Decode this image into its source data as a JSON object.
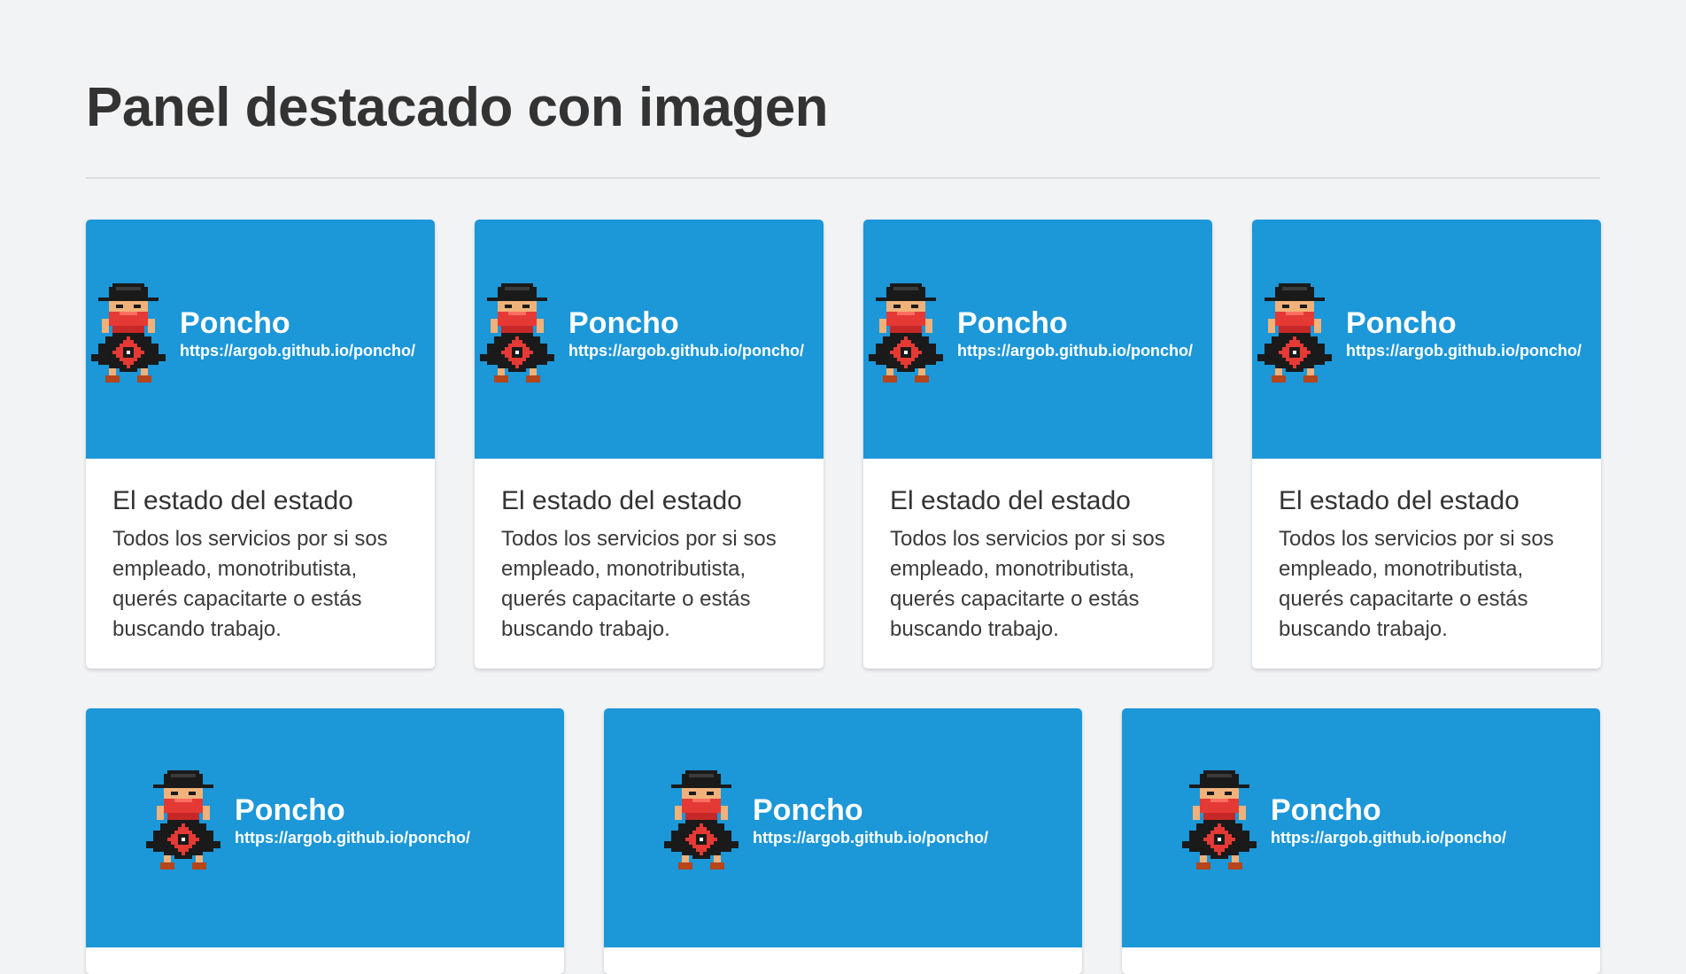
{
  "page": {
    "title": "Panel destacado con imagen"
  },
  "colors": {
    "background": "#f2f3f5",
    "banner": "#1c97d8",
    "card": "#ffffff"
  },
  "cards_row1": [
    {
      "brand_name": "Poncho",
      "brand_url": "https://argob.github.io/poncho/",
      "icon": "poncho-mascot-icon",
      "title": "El estado del estado",
      "text": "Todos los servicios por si sos empleado, monotributista, querés capacitarte o estás buscando trabajo."
    },
    {
      "brand_name": "Poncho",
      "brand_url": "https://argob.github.io/poncho/",
      "icon": "poncho-mascot-icon",
      "title": "El estado del estado",
      "text": "Todos los servicios por si sos empleado, monotributista, querés capacitarte o estás buscando trabajo."
    },
    {
      "brand_name": "Poncho",
      "brand_url": "https://argob.github.io/poncho/",
      "icon": "poncho-mascot-icon",
      "title": "El estado del estado",
      "text": "Todos los servicios por si sos empleado, monotributista, querés capacitarte o estás buscando trabajo."
    },
    {
      "brand_name": "Poncho",
      "brand_url": "https://argob.github.io/poncho/",
      "icon": "poncho-mascot-icon",
      "title": "El estado del estado",
      "text": "Todos los servicios por si sos empleado, monotributista, querés capacitarte o estás buscando trabajo."
    }
  ],
  "cards_row2": [
    {
      "brand_name": "Poncho",
      "brand_url": "https://argob.github.io/poncho/",
      "icon": "poncho-mascot-icon"
    },
    {
      "brand_name": "Poncho",
      "brand_url": "https://argob.github.io/poncho/",
      "icon": "poncho-mascot-icon"
    },
    {
      "brand_name": "Poncho",
      "brand_url": "https://argob.github.io/poncho/",
      "icon": "poncho-mascot-icon"
    }
  ]
}
